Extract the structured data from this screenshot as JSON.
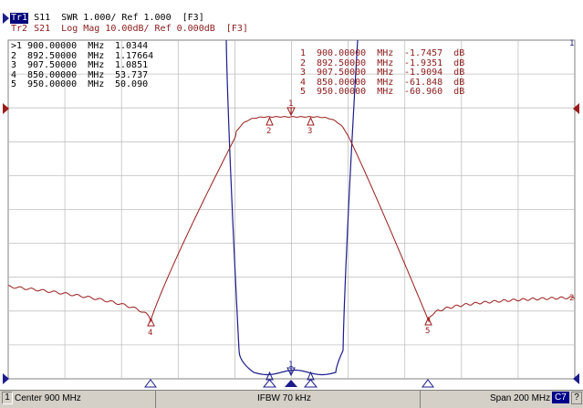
{
  "traces": {
    "tr1": {
      "tag": "Tr1",
      "text": " S11  SWR 1.000/ Ref 1.000  [F3]",
      "color": "#00007a"
    },
    "tr2": {
      "tag": "Tr2",
      "text": " S21  Log Mag 10.00dB/ Ref 0.000dB  [F3]",
      "color": "#8b1a1a"
    }
  },
  "markers_tr1": [
    {
      "no": ">1",
      "freq": "900.00000  MHz",
      "value": "1.0344"
    },
    {
      "no": "2",
      "freq": "892.50000  MHz",
      "value": "1.17664"
    },
    {
      "no": "3",
      "freq": "907.50000  MHz",
      "value": "1.0851"
    },
    {
      "no": "4",
      "freq": "850.00000  MHz",
      "value": "53.737"
    },
    {
      "no": "5",
      "freq": "950.00000  MHz",
      "value": "50.090"
    }
  ],
  "markers_tr2": [
    {
      "no": "1",
      "freq": "900.00000  MHz",
      "value": "-1.7457  dB"
    },
    {
      "no": "2",
      "freq": "892.50000  MHz",
      "value": "-1.9351  dB"
    },
    {
      "no": "3",
      "freq": "907.50000  MHz",
      "value": "-1.9094  dB"
    },
    {
      "no": "4",
      "freq": "850.00000  MHz",
      "value": "-61.848  dB"
    },
    {
      "no": "5",
      "freq": "950.00000  MHz",
      "value": "-60.960  dB"
    }
  ],
  "marker_labels": {
    "m1": "1",
    "m2": "2",
    "m3": "3",
    "m4": "4",
    "m5": "5"
  },
  "ref_labels": {
    "tr1": "1",
    "tr2": "2"
  },
  "status": {
    "channel": "1",
    "center": "Center 900 MHz",
    "ifbw": "IFBW 70 kHz",
    "span": "Span 200 MHz",
    "c7": "C7",
    "q": "?"
  },
  "colors": {
    "grid": "#c0c0c0",
    "tr1": "#1c1c8c",
    "tr2": "#9b1b1b",
    "background": "#ffffff"
  }
}
